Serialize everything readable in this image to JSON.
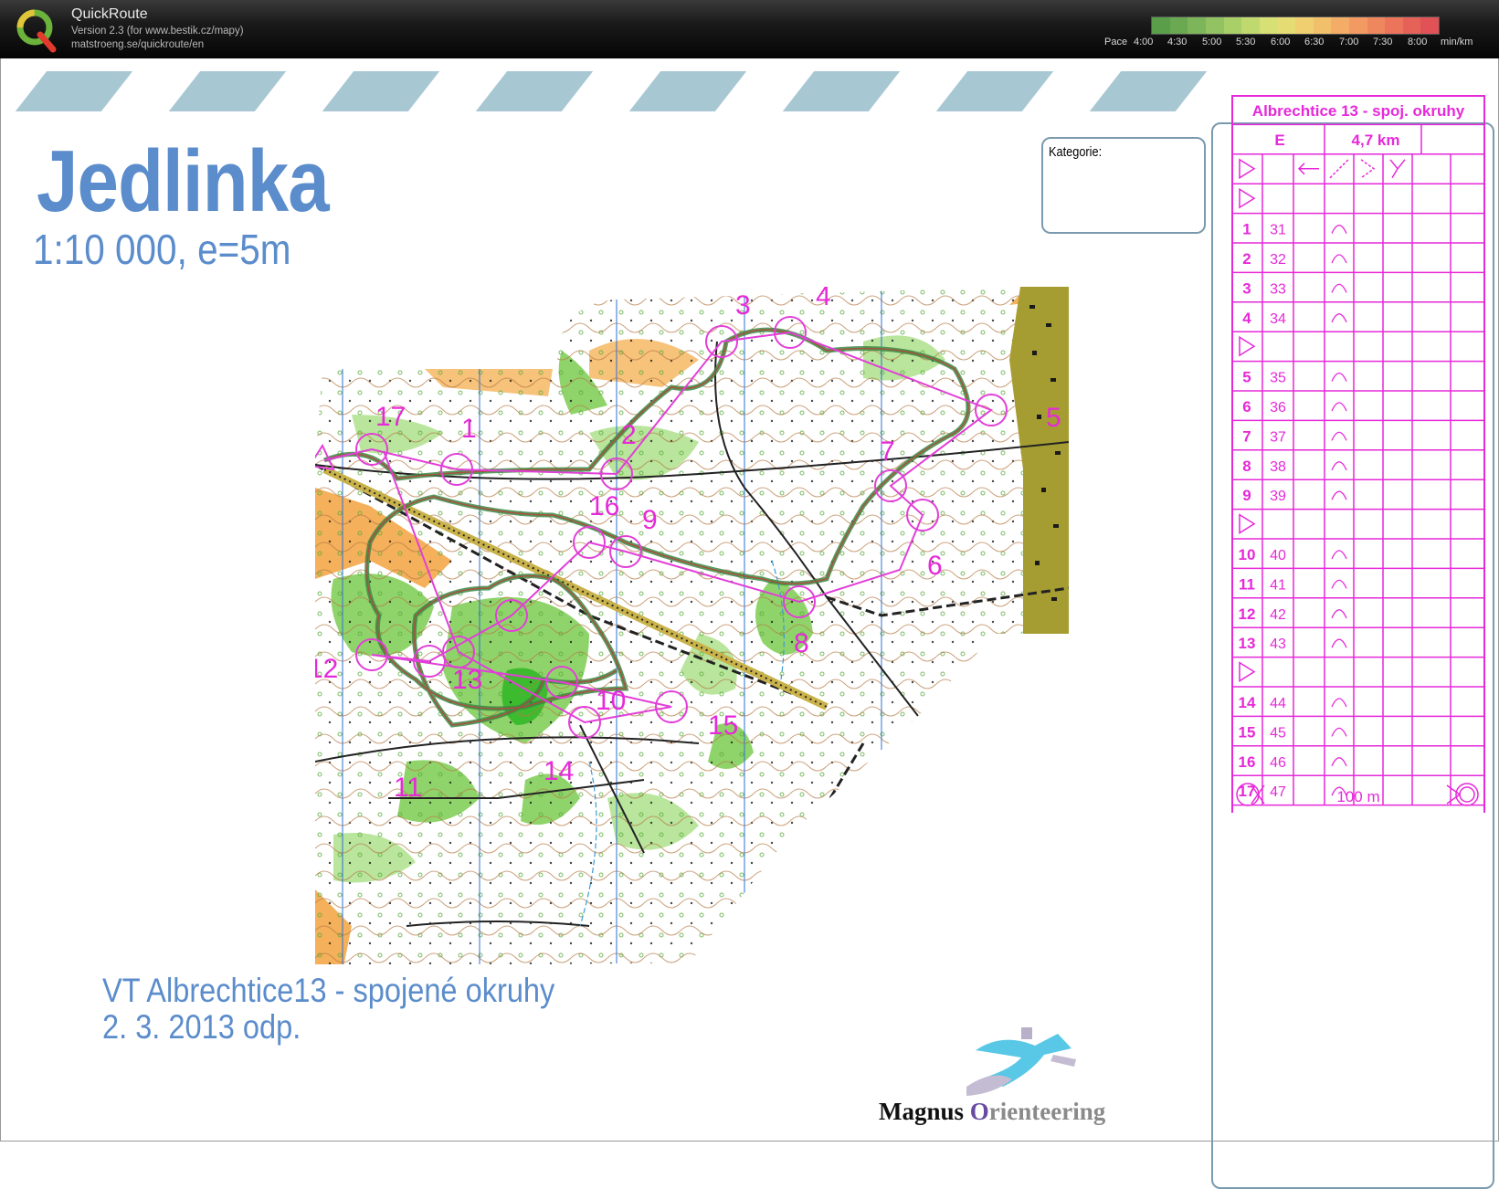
{
  "app": {
    "title": "QuickRoute",
    "version": "Version 2.3  (for www.bestik.cz/mapy)",
    "url": "matstroeng.se/quickroute/en",
    "logo_letter": "Q"
  },
  "pace_legend": {
    "label": "Pace",
    "ticks": [
      "4:00",
      "4:30",
      "5:00",
      "5:30",
      "6:00",
      "6:30",
      "7:00",
      "7:30",
      "8:00"
    ],
    "unit": "min/km",
    "colors": [
      "#5a9e4a",
      "#6aa852",
      "#7db55a",
      "#92c262",
      "#a9cf69",
      "#c0d96f",
      "#d6e074",
      "#e6dc74",
      "#efcf70",
      "#f2bf6b",
      "#f3ad66",
      "#f29a62",
      "#ef875e",
      "#eb745b",
      "#e66258",
      "#e15256"
    ]
  },
  "sheet": {
    "title": "Jedlinka",
    "scale": "1:10 000, e=5m",
    "category_label": "Kategorie:",
    "footer_line1": "VT Albrechtice13 - spojené okruhy",
    "footer_line2": "2. 3. 2013 odp.",
    "club_logo": {
      "prefix": "Magnus ",
      "accent_letter": "O",
      "rest": "rienteering"
    }
  },
  "map": {
    "control_labels": [
      "1",
      "2",
      "3",
      "4",
      "5",
      "6",
      "7",
      "8",
      "9",
      "10",
      "11",
      "12",
      "13",
      "14",
      "15",
      "16",
      "17"
    ]
  },
  "control_descriptions": {
    "title": "Albrechtice 13 - spoj. okruhy",
    "class": "E",
    "length": "4,7 km",
    "finish_distance": "100 m",
    "rows": [
      {
        "type": "start"
      },
      {
        "no": "1",
        "code": "31"
      },
      {
        "no": "2",
        "code": "32"
      },
      {
        "no": "3",
        "code": "33"
      },
      {
        "no": "4",
        "code": "34"
      },
      {
        "type": "start"
      },
      {
        "no": "5",
        "code": "35"
      },
      {
        "no": "6",
        "code": "36"
      },
      {
        "no": "7",
        "code": "37"
      },
      {
        "no": "8",
        "code": "38"
      },
      {
        "no": "9",
        "code": "39"
      },
      {
        "type": "start"
      },
      {
        "no": "10",
        "code": "40"
      },
      {
        "no": "11",
        "code": "41"
      },
      {
        "no": "12",
        "code": "42"
      },
      {
        "no": "13",
        "code": "43"
      },
      {
        "type": "start"
      },
      {
        "no": "14",
        "code": "44"
      },
      {
        "no": "15",
        "code": "45"
      },
      {
        "no": "16",
        "code": "46"
      },
      {
        "no": "17",
        "code": "47"
      }
    ]
  }
}
